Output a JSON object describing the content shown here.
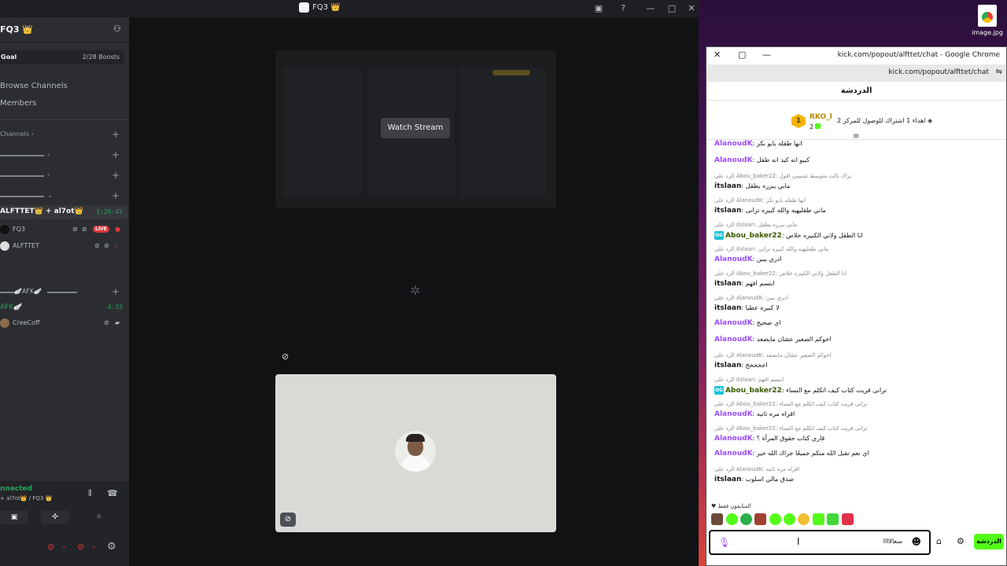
{
  "discord": {
    "window_title": "FQ3 👑",
    "server_name": "FQ3 👑",
    "goal_label": "Goal",
    "boosts": "2/28 Boosts",
    "browse_channels": "Browse Channels",
    "members": "Members",
    "channels_category": "Channels",
    "afk_category": "🪽AFK🪽",
    "voice_channel": "ALFTTET👑 + al7ot👑",
    "voice_timer": "1:26:42",
    "users": [
      {
        "name": "FQ3",
        "live": "LIVE"
      },
      {
        "name": "ALFTTET"
      }
    ],
    "afk_channel": "AFK🪽",
    "afk_timer": "4:33",
    "afk_user": "CreeCoff",
    "voice_status": "nnected",
    "voice_sub": "+ al7ot👑 / FQ3 👑",
    "watch_stream": "Watch Stream"
  },
  "desktop": {
    "file_label": "image.jpg"
  },
  "chrome": {
    "title": "kick.com/popout/alfttet/chat - Google Chrome",
    "url": "kick.com/popout/alfttet/chat",
    "chat_header": "الدردشة",
    "pinned": {
      "rank": "1",
      "name": "RKO_l",
      "sub": "2",
      "text": "اهداء 1 اشتراك للوصول للمركز 2"
    },
    "messages": [
      {
        "reply": "",
        "user": "AlanoudK",
        "color": "purple",
        "text": "انها طقله يابو بكر"
      },
      {
        "reply": "",
        "user": "AlanoudK",
        "color": "purple",
        "text": "كيبو انه كيد انه طقل"
      },
      {
        "reply": "الرد على Abou_baker22: تراك ثالث متوسط شتبيني اقول",
        "user": "itslaan",
        "color": "dark",
        "text": "مابي يبزره يطقل"
      },
      {
        "reply": "الرد على AlanoudK: انها طقله يابو بكر",
        "user": "itslaan",
        "color": "dark",
        "text": "ماني طقليهيه والله كبيره ترانى"
      },
      {
        "reply": "الرد على itslaan: مابي يبزره يطقل",
        "user": "Abou_baker22",
        "color": "teal",
        "og": true,
        "text": "انا الطقل ولاني الكبيره خلاص"
      },
      {
        "reply": "الرد على itslaan: ماني طقليهيه والله كبيره ترانى",
        "user": "AlanoudK",
        "color": "purple",
        "text": "ادري بيبن"
      },
      {
        "reply": "الرد على Abou_baker22: انا الطقل ولاني الكبيره خلاص",
        "user": "itslaan",
        "color": "dark",
        "text": "ابتسم افهم"
      },
      {
        "reply": "الرد على AlanoudK: ادري بيبن",
        "user": "itslaan",
        "color": "dark",
        "text": "لا كبيره عطيا"
      },
      {
        "reply": "",
        "user": "AlanoudK",
        "color": "purple",
        "text": "اي صحيح"
      },
      {
        "reply": "",
        "user": "AlanoudK",
        "color": "purple",
        "text": "اخوكم الصغير عشان مايضعد"
      },
      {
        "reply": "الرد على AlanoudK: اخوكم الصغير عشان مايضعد",
        "user": "itslaan",
        "color": "dark",
        "text": "اخخخخخ"
      },
      {
        "reply": "الرد على itslaan: ابتسم افهم",
        "user": "Abou_baker22",
        "color": "teal",
        "og": true,
        "text": "ترانى قريت كتاب كيف اتكلم مع النساء"
      },
      {
        "reply": "الرد على Abou_baker22: ترانى قريت كتاب كيف اتكلم مع النساء",
        "user": "AlanoudK",
        "color": "purple",
        "text": "اقراه مره ثانيه"
      },
      {
        "reply": "الرد على Abou_baker22: ترانى قريت كتاب كيف اتكلم مع النساء",
        "user": "AlanoudK",
        "color": "purple",
        "text": "قاري كتاب حقوق المرأة ؟"
      },
      {
        "reply": "",
        "user": "AlanoudK",
        "color": "purple",
        "text": "اي نعم تقبل الله منكم جميعًا جزاك الله خير"
      },
      {
        "reply": "الرد على AlanoudK: اقراه مره ثانيه",
        "user": "itslaan",
        "color": "dark",
        "text": "صدق مالي اسلوب"
      }
    ],
    "emote_label": "المتابعون فقط",
    "input_text": "سعالاااا",
    "send_label": "الدردشة"
  },
  "colors": {
    "discord_bg": "#1e1f22",
    "kick_green": "#53fc18",
    "purple_user": "#9b4dff",
    "live_red": "#da373c"
  }
}
